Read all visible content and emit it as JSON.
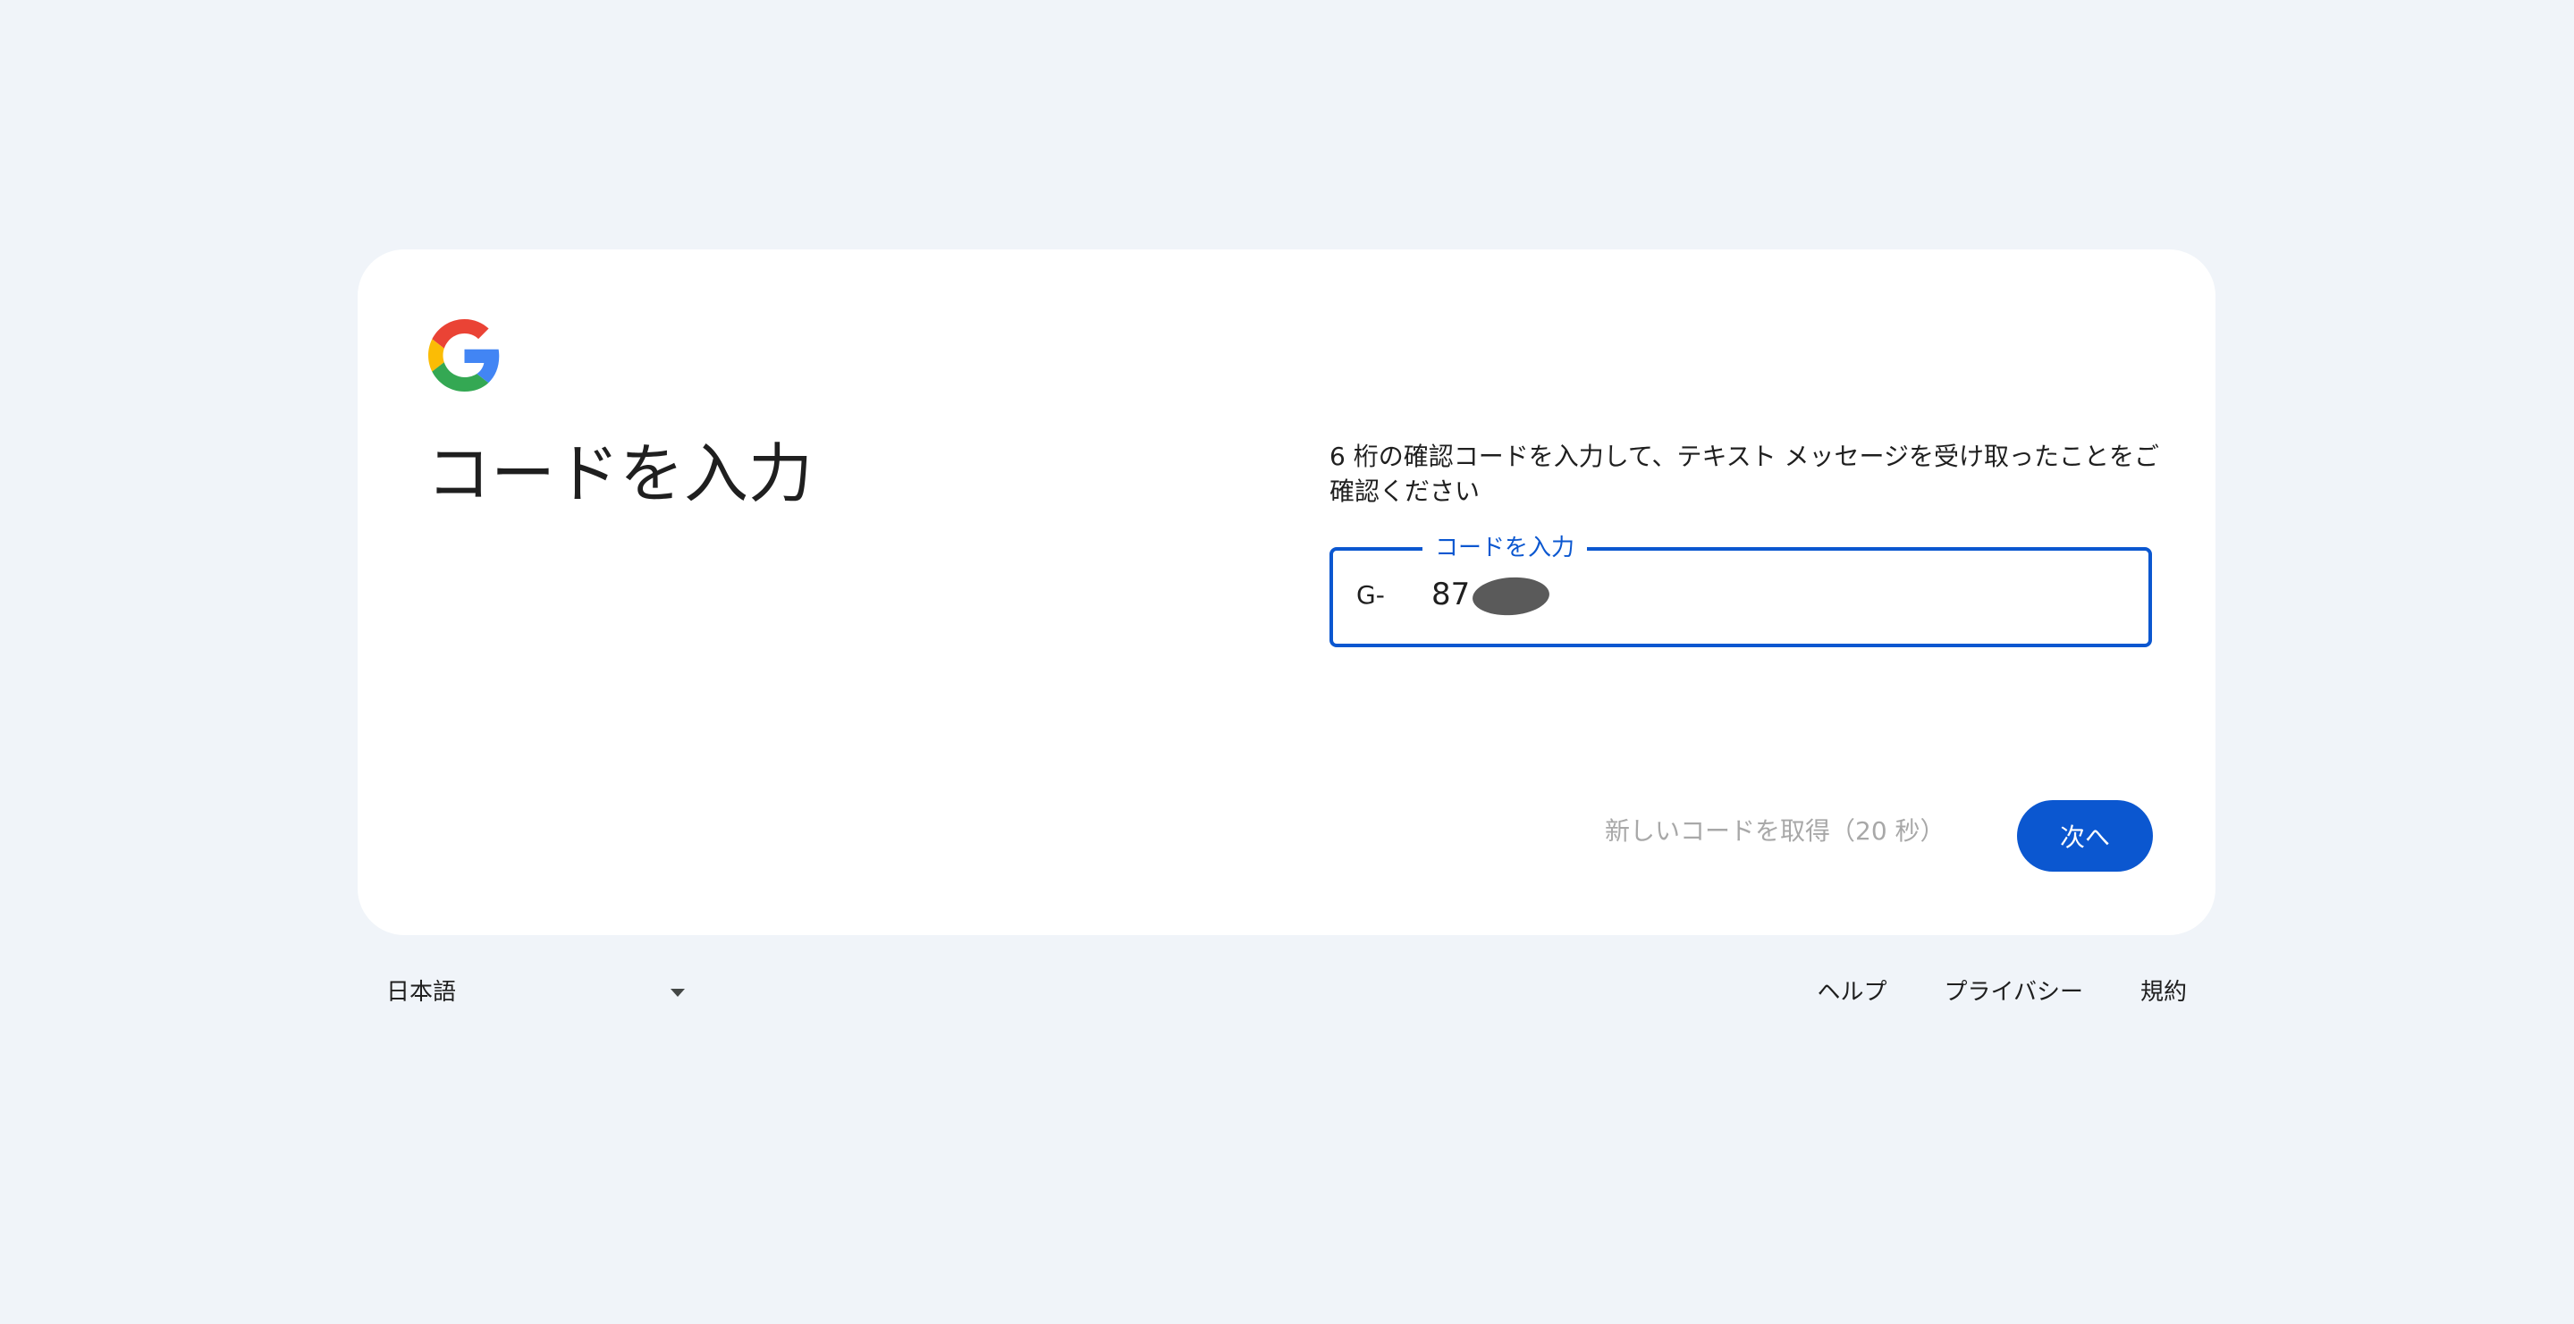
{
  "card": {
    "logo_icon": "google-g-logo",
    "title": "コードを入力",
    "description": "6 桁の確認コードを入力して、テキスト メッセージを受け取ったことをご確認ください",
    "code_field": {
      "label": "コードを入力",
      "prefix": "G-",
      "value": "87"
    },
    "resend_label": "新しいコードを取得（20 秒）",
    "next_label": "次へ"
  },
  "footer": {
    "language": "日本語",
    "links": {
      "help": "ヘルプ",
      "privacy": "プライバシー",
      "terms": "規約"
    }
  },
  "colors": {
    "background": "#f0f4f9",
    "accent": "#0b57d0",
    "disabled_text": "#a8a8a8"
  }
}
